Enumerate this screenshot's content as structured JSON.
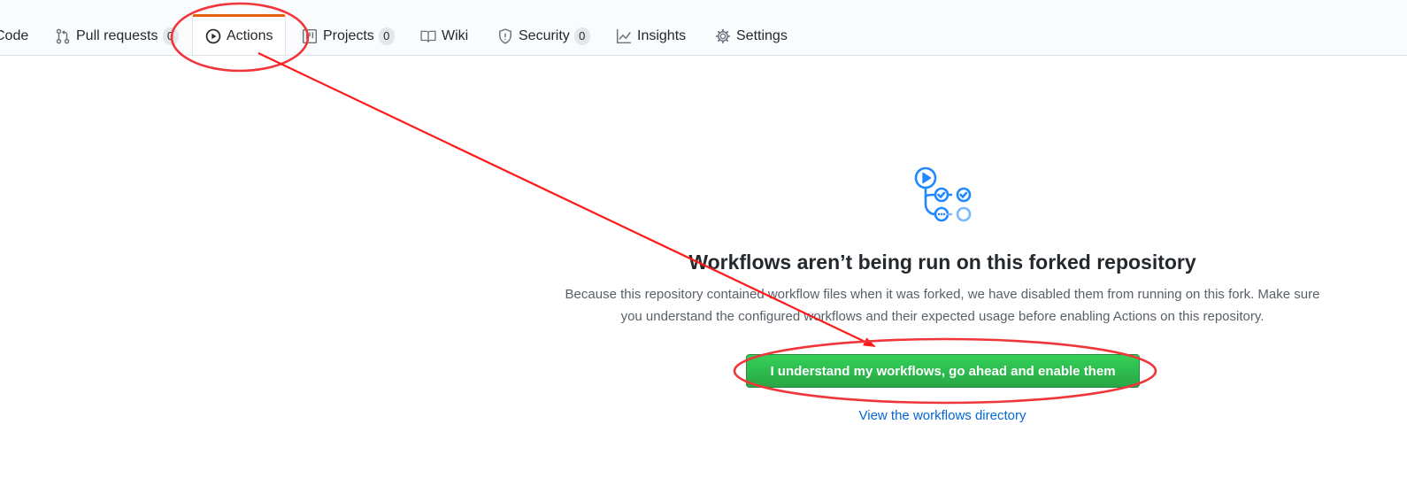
{
  "tabs": [
    {
      "id": "code",
      "label": "Code",
      "icon": "code-icon"
    },
    {
      "id": "pull-requests",
      "label": "Pull requests",
      "count": "0",
      "icon": "git-pull-request-icon"
    },
    {
      "id": "actions",
      "label": "Actions",
      "icon": "play-icon",
      "selected": true
    },
    {
      "id": "projects",
      "label": "Projects",
      "count": "0",
      "icon": "project-icon"
    },
    {
      "id": "wiki",
      "label": "Wiki",
      "icon": "book-icon"
    },
    {
      "id": "security",
      "label": "Security",
      "count": "0",
      "icon": "shield-icon"
    },
    {
      "id": "insights",
      "label": "Insights",
      "icon": "graph-icon"
    },
    {
      "id": "settings",
      "label": "Settings",
      "icon": "gear-icon"
    }
  ],
  "blankslate": {
    "icon": "workflow-icon",
    "title": "Workflows aren’t being run on this forked repository",
    "description_line1": "Because this repository contained workflow files when it was forked, we have disabled them from running on this fork. Make sure",
    "description_line2": "you understand the configured workflows and their expected usage before enabling Actions on this repository.",
    "enable_button": "I understand my workflows, go ahead and enable them",
    "view_link": "View the workflows directory"
  },
  "colors": {
    "accent_tab": "#e36209",
    "button_green": "#28a745",
    "link_blue": "#0366d6",
    "annotation_red": "#ff0000"
  }
}
